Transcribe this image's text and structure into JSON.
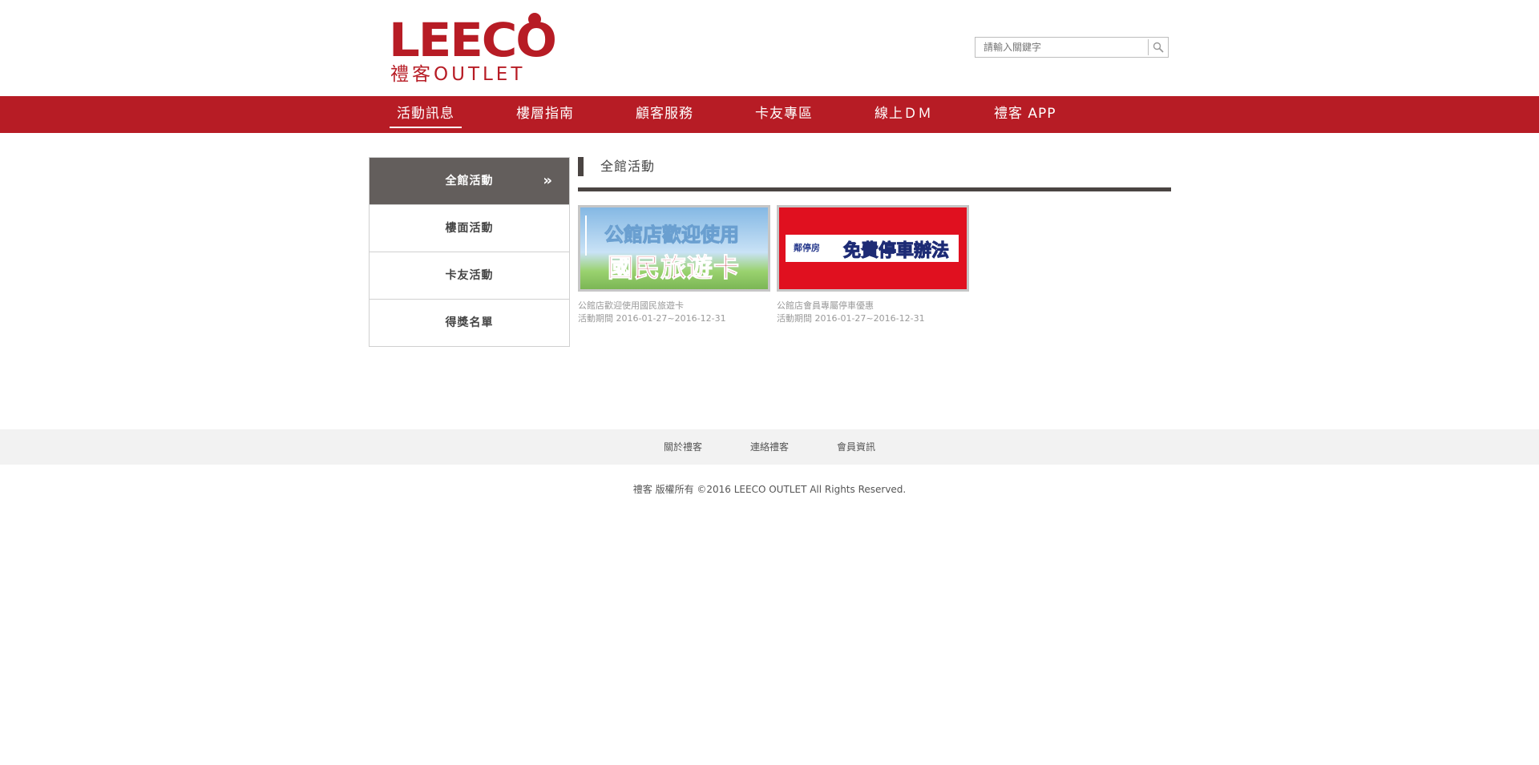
{
  "brand": {
    "logo_main": "LEECO",
    "logo_sub": "禮客OUTLET",
    "color": "#b71c25"
  },
  "search": {
    "placeholder": "請輸入關鍵字"
  },
  "nav": {
    "items": [
      {
        "label": "活動訊息",
        "active": true
      },
      {
        "label": "樓層指南"
      },
      {
        "label": "顧客服務"
      },
      {
        "label": "卡友專區"
      },
      {
        "label": "線上ＤＭ"
      },
      {
        "label": "禮客 APP"
      }
    ]
  },
  "sidebar": {
    "items": [
      {
        "label": "全館活動",
        "active": true,
        "arrow": "»"
      },
      {
        "label": "樓面活動"
      },
      {
        "label": "卡友活動"
      },
      {
        "label": "得獎名單"
      }
    ]
  },
  "section": {
    "title": "全館活動"
  },
  "activities": [
    {
      "image_text_1": "公館店歡迎使用",
      "image_text_2": "國民旅遊卡",
      "caption": "公館店歡迎使用國民旅遊卡",
      "period": "活動期間 2016-01-27~2016-12-31"
    },
    {
      "image_logo": "鄰停房",
      "image_text": "免費停車辦法",
      "caption": "公館店會員專屬停車優惠",
      "period": "活動期間 2016-01-27~2016-12-31"
    }
  ],
  "footer": {
    "links": [
      "關於禮客",
      "連絡禮客",
      "會員資訊"
    ],
    "copyright": "禮客 版權所有 ©2016 LEECO OUTLET All Rights Reserved."
  }
}
